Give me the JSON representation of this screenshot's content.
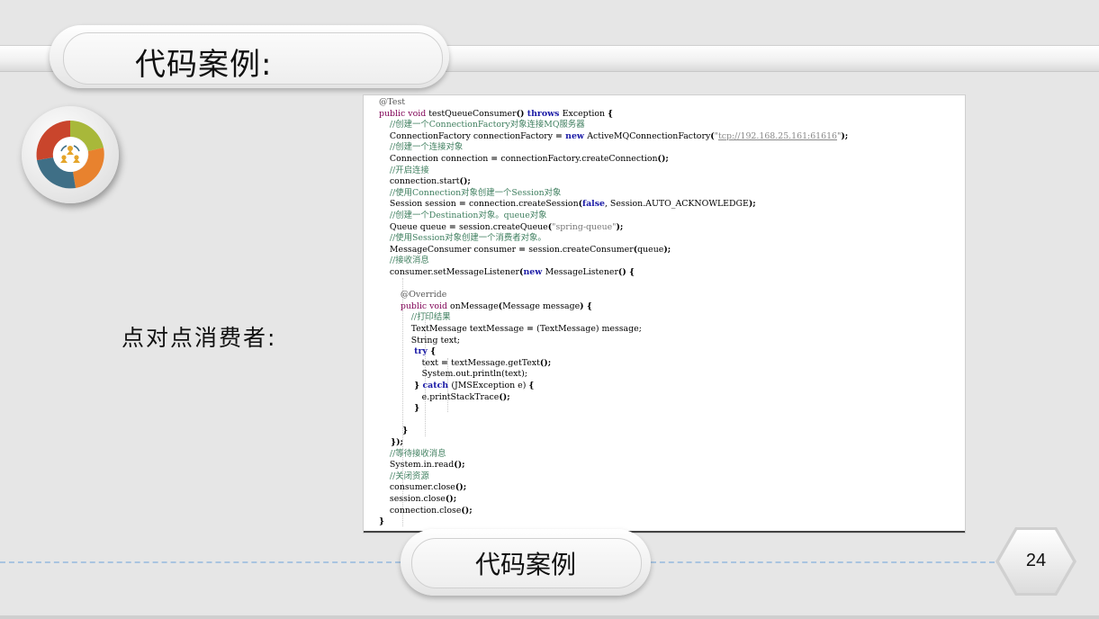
{
  "slide": {
    "title": "代码案例:",
    "side_label": "点对点消费者:",
    "footer_label": "代码案例",
    "page_number": "24"
  },
  "colors": {
    "background": "#e6e6e6",
    "comment": "#3f7f5f",
    "keyword": "#7f0055",
    "bold_keyword": "#1a1aa6",
    "string": "#777777",
    "dash": "#a9c4e0"
  },
  "icons": {
    "logo": "circular-arrows-people-icon"
  },
  "code": {
    "lines": [
      [
        {
          "t": "@Test",
          "c": "ann"
        }
      ],
      [
        {
          "t": "public void ",
          "c": "kw"
        },
        {
          "t": "testQueueConsumer"
        },
        {
          "t": "() ",
          "c": "br"
        },
        {
          "t": "throws ",
          "c": "kw2"
        },
        {
          "t": "Exception "
        },
        {
          "t": "{",
          "c": "br"
        }
      ],
      [
        {
          "t": "    //创建一个ConnectionFactory对象连接MQ服务器",
          "c": "cm"
        }
      ],
      [
        {
          "t": "    ConnectionFactory connectionFactory "
        },
        {
          "t": "= ",
          "c": "br"
        },
        {
          "t": "new ",
          "c": "kw2"
        },
        {
          "t": "ActiveMQConnectionFactory"
        },
        {
          "t": "(",
          "c": "br"
        },
        {
          "t": "\"",
          "c": "str"
        },
        {
          "t": "tcp://192.168.25.161:61616",
          "c": "link"
        },
        {
          "t": "\"",
          "c": "str"
        },
        {
          "t": ");",
          "c": "br"
        }
      ],
      [
        {
          "t": "    //创建一个连接对象",
          "c": "cm"
        }
      ],
      [
        {
          "t": "    Connection connection "
        },
        {
          "t": "= ",
          "c": "br"
        },
        {
          "t": "connectionFactory.createConnection"
        },
        {
          "t": "();",
          "c": "br"
        }
      ],
      [
        {
          "t": "    //开启连接",
          "c": "cm"
        }
      ],
      [
        {
          "t": "    connection.start"
        },
        {
          "t": "();",
          "c": "br"
        }
      ],
      [
        {
          "t": "    //使用Connection对象创建一个Session对象",
          "c": "cm"
        }
      ],
      [
        {
          "t": "    Session session "
        },
        {
          "t": "= ",
          "c": "br"
        },
        {
          "t": "connection.createSession"
        },
        {
          "t": "(",
          "c": "br"
        },
        {
          "t": "false",
          "c": "kw2"
        },
        {
          "t": ", Session.AUTO_ACKNOWLEDGE"
        },
        {
          "t": ");",
          "c": "br"
        }
      ],
      [
        {
          "t": "    //创建一个Destination对象。queue对象",
          "c": "cm"
        }
      ],
      [
        {
          "t": "    Queue queue "
        },
        {
          "t": "= ",
          "c": "br"
        },
        {
          "t": "session.createQueue"
        },
        {
          "t": "(",
          "c": "br"
        },
        {
          "t": "\"spring-queue\"",
          "c": "str"
        },
        {
          "t": ");",
          "c": "br"
        }
      ],
      [
        {
          "t": "    //使用Session对象创建一个消费者对象。",
          "c": "cm"
        }
      ],
      [
        {
          "t": "    MessageConsumer consumer "
        },
        {
          "t": "= ",
          "c": "br"
        },
        {
          "t": "session.createConsumer"
        },
        {
          "t": "(",
          "c": "br"
        },
        {
          "t": "queue"
        },
        {
          "t": ");",
          "c": "br"
        }
      ],
      [
        {
          "t": "    //接收消息",
          "c": "cm"
        }
      ],
      [
        {
          "t": "    consumer.setMessageListener"
        },
        {
          "t": "(",
          "c": "br"
        },
        {
          "t": "new ",
          "c": "kw2"
        },
        {
          "t": "MessageListener"
        },
        {
          "t": "() {",
          "c": "br"
        }
      ],
      [
        {
          "t": ""
        }
      ],
      [
        {
          "t": "        @Override",
          "c": "ann"
        }
      ],
      [
        {
          "t": "        public void ",
          "c": "kw"
        },
        {
          "t": "onMessage"
        },
        {
          "t": "(",
          "c": "br"
        },
        {
          "t": "Message message"
        },
        {
          "t": ") {",
          "c": "br"
        }
      ],
      [
        {
          "t": "            //打印结果",
          "c": "cm"
        }
      ],
      [
        {
          "t": "            TextMessage textMessage "
        },
        {
          "t": "= ",
          "c": "br"
        },
        {
          "t": "(TextMessage) message;"
        }
      ],
      [
        {
          "t": "            String text;"
        }
      ],
      [
        {
          "t": "            try ",
          "c": "kw2"
        },
        {
          "t": "{",
          "c": "br"
        }
      ],
      [
        {
          "t": "                text "
        },
        {
          "t": "= ",
          "c": "br"
        },
        {
          "t": "textMessage.getText"
        },
        {
          "t": "();",
          "c": "br"
        }
      ],
      [
        {
          "t": "                System.out.println(text);"
        }
      ],
      [
        {
          "t": "            } ",
          "c": "br"
        },
        {
          "t": "catch ",
          "c": "kw2"
        },
        {
          "t": "(JMSException e) "
        },
        {
          "t": "{",
          "c": "br"
        }
      ],
      [
        {
          "t": "                e.printStackTrace"
        },
        {
          "t": "();",
          "c": "br"
        }
      ],
      [
        {
          "t": "            }",
          "c": "br"
        }
      ],
      [
        {
          "t": ""
        }
      ],
      [
        {
          "t": "        }",
          "c": "br"
        }
      ],
      [
        {
          "t": "    });",
          "c": "br"
        }
      ],
      [
        {
          "t": "    //等待接收消息",
          "c": "cm"
        }
      ],
      [
        {
          "t": "    System.in.read"
        },
        {
          "t": "();",
          "c": "br"
        }
      ],
      [
        {
          "t": "    //关闭资源",
          "c": "cm"
        }
      ],
      [
        {
          "t": "    consumer.close"
        },
        {
          "t": "();",
          "c": "br"
        }
      ],
      [
        {
          "t": "    session.close"
        },
        {
          "t": "();",
          "c": "br"
        }
      ],
      [
        {
          "t": "    connection.close"
        },
        {
          "t": "();",
          "c": "br"
        }
      ],
      [
        {
          "t": "}",
          "c": "br"
        }
      ]
    ]
  }
}
